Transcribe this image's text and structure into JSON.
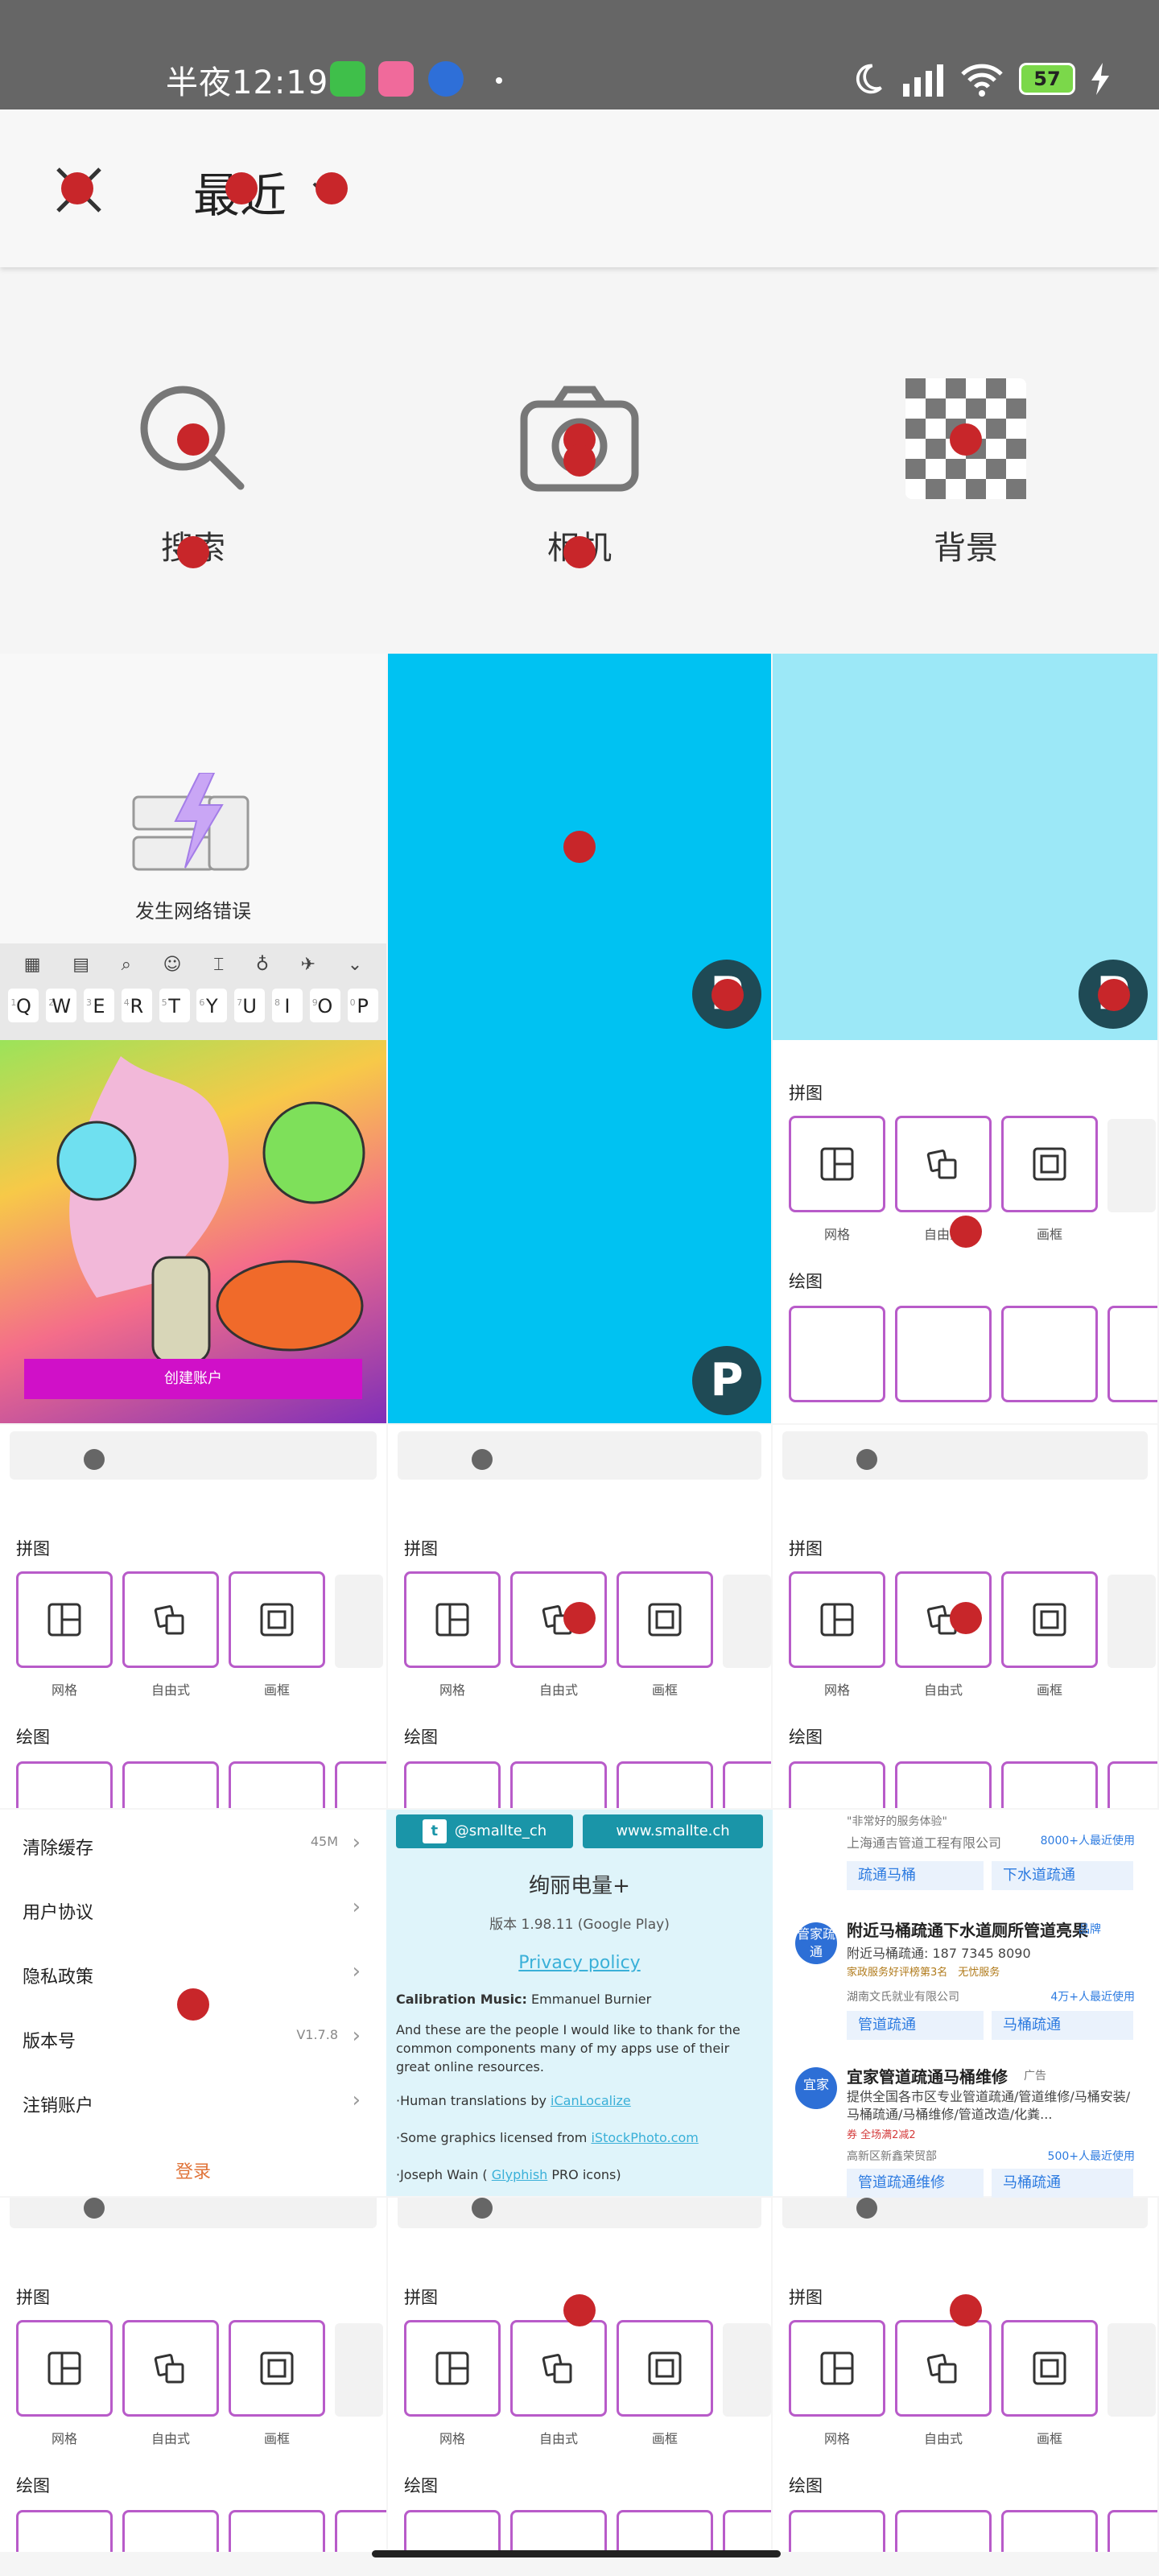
{
  "status_bar": {
    "time": "半夜12:19",
    "apps": [
      "android-robot-icon",
      "bilibili-icon",
      "baidu-icon"
    ],
    "battery": "57"
  },
  "app_bar": {
    "title": "最近"
  },
  "sources": [
    {
      "label": "搜索",
      "icon": "search-icon"
    },
    {
      "label": "相机",
      "icon": "camera-icon"
    },
    {
      "label": "背景",
      "icon": "transparent-background-icon"
    }
  ],
  "network_error": {
    "text": "发生网络错误"
  },
  "keyboard": {
    "keys": [
      {
        "k": "Q",
        "n": "1"
      },
      {
        "k": "W",
        "n": "2"
      },
      {
        "k": "E",
        "n": "3"
      },
      {
        "k": "R",
        "n": "4"
      },
      {
        "k": "T",
        "n": "5"
      },
      {
        "k": "Y",
        "n": "6"
      },
      {
        "k": "U",
        "n": "7"
      },
      {
        "k": "I",
        "n": "8"
      },
      {
        "k": "O",
        "n": "9"
      },
      {
        "k": "P",
        "n": "0"
      }
    ]
  },
  "photo_tile": {
    "button": "创建账户"
  },
  "collage": {
    "section_collage": "拼图",
    "section_draw": "绘图",
    "frames": [
      {
        "label": "网格",
        "icon": "grid-layout-icon"
      },
      {
        "label": "自由式",
        "icon": "freestyle-icon"
      },
      {
        "label": "画框",
        "icon": "frame-icon"
      }
    ]
  },
  "settings": {
    "rows": [
      {
        "label": "清除缓存",
        "value": "45M"
      },
      {
        "label": "用户协议",
        "value": ""
      },
      {
        "label": "隐私政策",
        "value": ""
      },
      {
        "label": "版本号",
        "value": "V1.7.8"
      },
      {
        "label": "注销账户",
        "value": ""
      }
    ],
    "login": "登录"
  },
  "about": {
    "twitter": "@smallte_ch",
    "website": "www.smallte.ch",
    "title": "绚丽电量+",
    "version": "版本 1.98.11 (Google Play)",
    "privacy": "Privacy policy",
    "music_label": "Calibration Music:",
    "music_name": "Emmanuel Burnier",
    "thanks": "And these are the people I would like to thank for the common components many of my apps use of their great online resources.",
    "translations_prefix": "·Human translations by ",
    "translations_link": "iCanLocalize",
    "graphics_prefix": "·Some graphics licensed from ",
    "graphics_link": "iStockPhoto.com",
    "icons_prefix": "·Joseph Wain ( ",
    "icons_link": "Glyphish",
    "icons_suffix": " PRO icons)"
  },
  "results": {
    "tagline": "\"非常好的服务体验\"",
    "company1": "上海通吉管道工程有限公司",
    "users1": "8000+人最近使用",
    "chips1": [
      "疏通马桶",
      "下水道疏通"
    ],
    "ad1": {
      "logo": "管家疏通",
      "title": "附近马桶疏通下水道厕所管道亮果",
      "tag": "品牌",
      "phone": "附近马桶疏通: 187 7345 8090",
      "badge": "家政服务好评榜第3名",
      "badge2": "无忧服务",
      "company": "湖南文氏就业有限公司",
      "users": "4万+人最近使用",
      "chips": [
        "管道疏通",
        "马桶疏通"
      ]
    },
    "ad2": {
      "logo": "宜家",
      "title": "宜家管道疏通马桶维修",
      "tag": "广告",
      "desc": "提供全国各市区专业管道疏通/管道维修/马桶安装/马桶疏通/马桶维修/管道改造/化粪...",
      "coupon": "券 全场满2减2",
      "company": "高新区新鑫荣贸部",
      "users": "500+人最近使用",
      "chips": [
        "管道疏通维修",
        "马桶疏通"
      ]
    }
  }
}
